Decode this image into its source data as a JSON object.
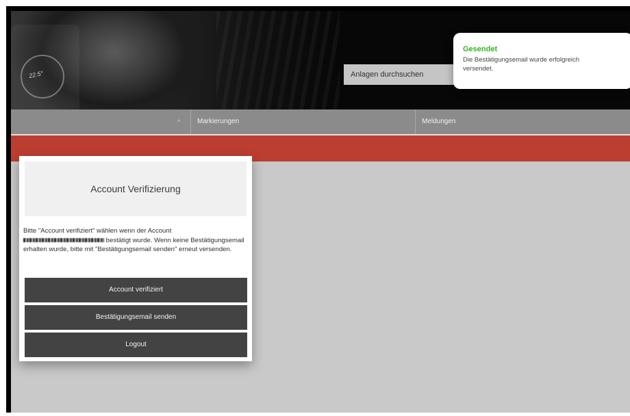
{
  "header": {
    "thermostat_value": "22.5°",
    "search": {
      "placeholder": "Anlagen durchsuchen"
    }
  },
  "nav": {
    "items": [
      {
        "label": ""
      },
      {
        "label": "Markierungen"
      },
      {
        "label": "Meldungen"
      }
    ]
  },
  "toast": {
    "title": "Gesendet",
    "message": "Die Bestätigungsemail wurde erfolgreich versendet."
  },
  "modal": {
    "title": "Account Verifizierung",
    "body_part1": "Bitte \"Account verifiziert\" wählen wenn der Account",
    "body_part2": "bestätigt wurde. Wenn keine Bestätigungsemail erhalten wurde, bitte mit \"Bestätigungsemail senden\" erneut versenden.",
    "buttons": {
      "verified": "Account verifiziert",
      "send_email": "Bestätigungsemail senden",
      "logout": "Logout"
    }
  },
  "colors": {
    "accent_red": "#bc3e31",
    "success_green": "#35b223",
    "button_dark": "#434343",
    "nav_gray": "#8b8b8b"
  }
}
